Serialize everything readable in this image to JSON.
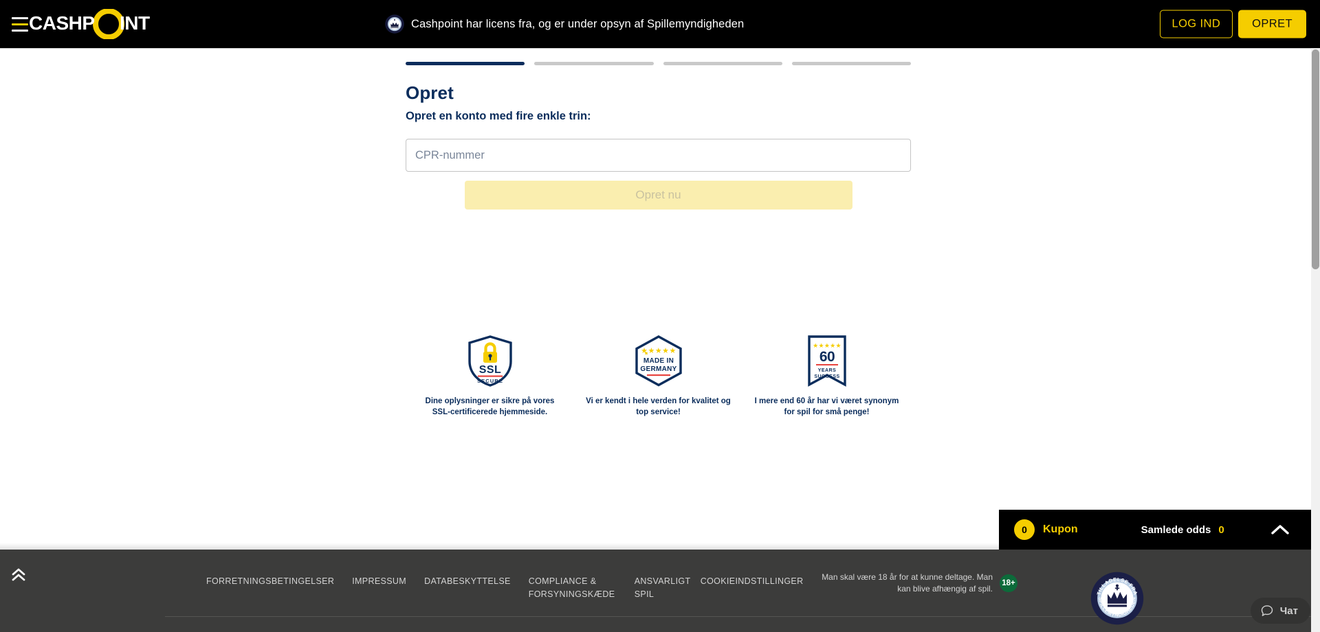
{
  "header": {
    "menu_icon": "hamburger-menu-icon",
    "brand": "CASHPOINT",
    "license_text": "Cashpoint har licens fra, og er under opsyn af Spillemyndigheden",
    "license_seal_icon": "spillemyndigheden-seal-icon",
    "login_label": "LOG IND",
    "signup_label": "OPRET"
  },
  "form": {
    "steps_total": 4,
    "steps_current": 1,
    "title": "Opret",
    "subtitle": "Opret en konto med fire enkle trin:",
    "cpr_placeholder": "CPR-nummer",
    "cpr_value": "",
    "submit_label": "Opret nu"
  },
  "badges": [
    {
      "icon": "ssl-secure-shield-icon",
      "art_main": "SSL",
      "art_sub": "SECURE",
      "caption": "Dine oplysninger er sikre på vores SSL-certificerede hjemmeside."
    },
    {
      "icon": "made-in-germany-hexagon-icon",
      "art_main": "MADE IN",
      "art_sub": "GERMANY",
      "caption": "Vi er kendt i hele verden for kvalitet og top service!"
    },
    {
      "icon": "60-years-success-ribbon-icon",
      "art_main": "60",
      "art_sub": "YEARS SUCCESS",
      "caption": "I mere end 60 år har vi været synonym for spil for små penge!"
    }
  ],
  "betslip": {
    "count": "0",
    "label": "Kupon",
    "odds_label": "Samlede odds",
    "odds_value": "0",
    "expand_icon": "chevron-up-icon"
  },
  "footer": {
    "scrolltop_icon": "double-chevron-up-icon",
    "links": [
      "FORRETNINGSBETINGELSER",
      "IMPRESSUM",
      "DATABESKYTTELSE",
      "COMPLIANCE & FORSYNINGSKÆDE",
      "ANSVARLIGT SPIL",
      "COOKIEINDSTILLINGER"
    ],
    "age_text": "Man skal være 18 år for at kunne deltage. Man kan blive afhængig af spil.",
    "age_badge": "18+",
    "seal_icon": "spillemyndigheden-seal-icon",
    "seal_top_text": "TILLADELSE FRA",
    "seal_bottom_text": "SPILLEMYNDIGHEDEN"
  },
  "chat": {
    "icon": "chat-bubble-icon",
    "label": "Чат"
  },
  "colors": {
    "brand_yellow": "#f5cd00",
    "navy": "#0b2d5c",
    "header_black": "#000000",
    "footer_gray": "#3c3c3b",
    "disabled_yellow": "#faeeaf",
    "age_green": "#0c6b3a"
  }
}
